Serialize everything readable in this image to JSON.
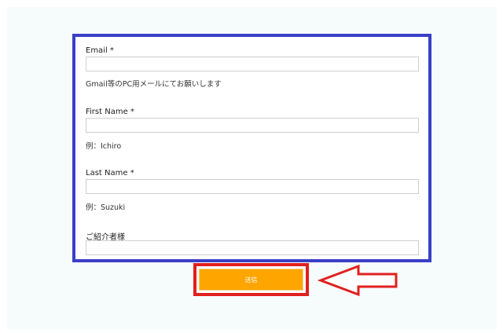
{
  "form": {
    "email": {
      "label": "Email *",
      "value": "",
      "hint": "Gmail等のPC用メールにてお願いします"
    },
    "first_name": {
      "label": "First Name *",
      "value": "",
      "hint": "例：Ichiro"
    },
    "last_name": {
      "label": "Last Name *",
      "value": "",
      "hint": "例：Suzuki"
    },
    "referrer": {
      "label": "ご紹介者様",
      "value": ""
    },
    "submit_label": "送信"
  },
  "colors": {
    "form_outline": "#3a3fc8",
    "submit_button": "#ffa500",
    "highlight": "#e0201e"
  },
  "icons": {
    "pointer": "arrow-left-icon"
  }
}
